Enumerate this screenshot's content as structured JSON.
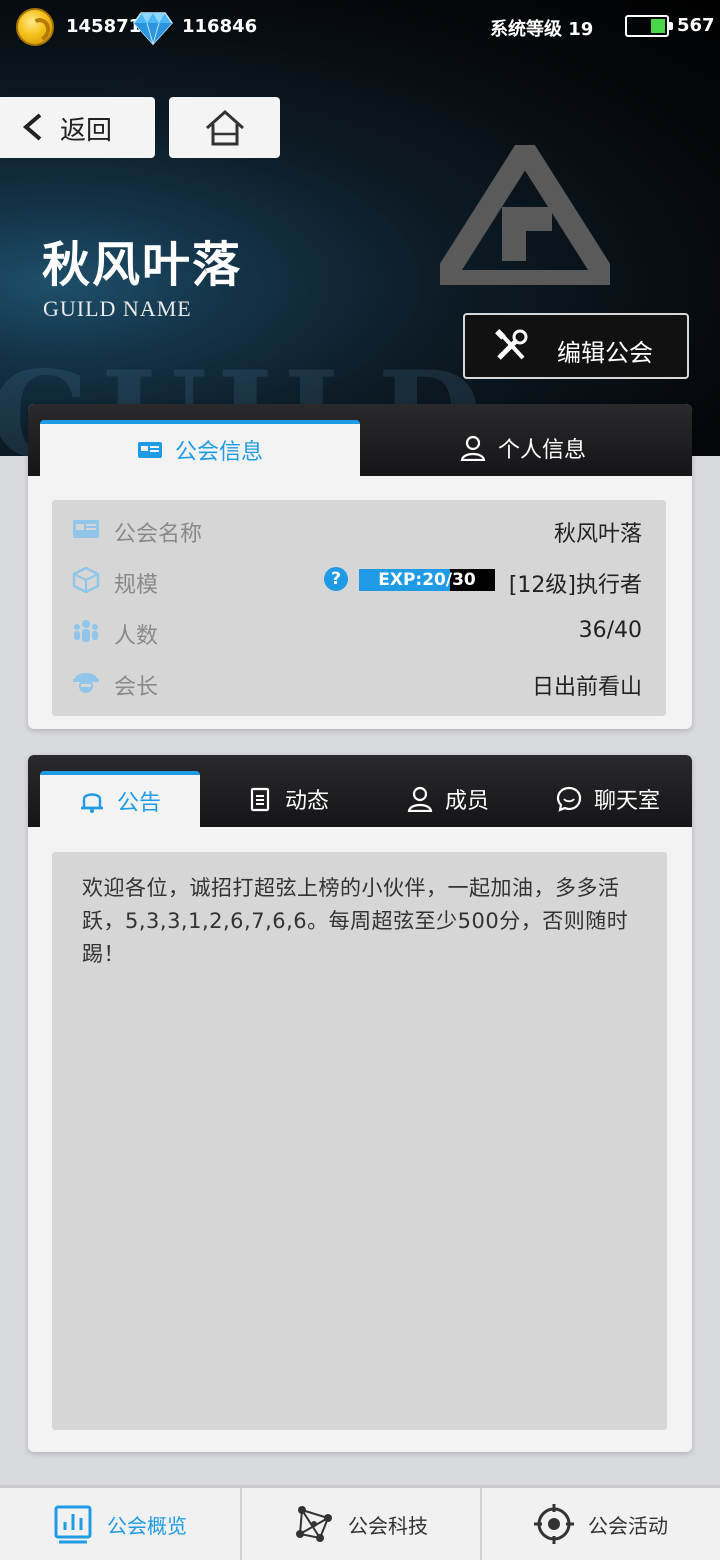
{
  "status_bar": {
    "coins": "145871",
    "diamonds": "116846",
    "system_level": "系统等级 19",
    "battery": "567"
  },
  "nav": {
    "back_label": "返回"
  },
  "guild": {
    "title": "秋风叶落",
    "subtitle": "GUILD NAME",
    "edit_label": "编辑公会"
  },
  "info_tabs": [
    {
      "label": "公会信息",
      "icon": "id-card-icon",
      "active": true
    },
    {
      "label": "个人信息",
      "icon": "person-icon",
      "active": false
    }
  ],
  "info": {
    "rows": [
      {
        "label": "公会名称",
        "value": "秋风叶落",
        "icon": "id-card-icon"
      },
      {
        "label": "规模",
        "value": "[12级]执行者",
        "icon": "cube-icon"
      },
      {
        "label": "人数",
        "value": "36/40",
        "icon": "people-icon"
      },
      {
        "label": "会长",
        "value": "日出前看山",
        "icon": "leader-icon"
      }
    ],
    "exp": {
      "text": "EXP:20/30",
      "current": 20,
      "max": 30
    }
  },
  "notice_tabs": [
    {
      "label": "公告",
      "icon": "bell-icon",
      "active": true
    },
    {
      "label": "动态",
      "icon": "clipboard-icon",
      "active": false
    },
    {
      "label": "成员",
      "icon": "person-icon",
      "active": false
    },
    {
      "label": "聊天室",
      "icon": "chat-icon",
      "active": false
    }
  ],
  "notice": {
    "text": "欢迎各位，诚招打超弦上榜的小伙伴，一起加油，多多活跃，5,3,3,1,2,6,7,6,6。每周超弦至少500分，否则随时踢！"
  },
  "bottom_nav": [
    {
      "label": "公会概览",
      "icon": "chart-icon",
      "active": true
    },
    {
      "label": "公会科技",
      "icon": "network-icon",
      "active": false
    },
    {
      "label": "公会活动",
      "icon": "target-icon",
      "active": false
    }
  ],
  "colors": {
    "accent": "#1f9be6",
    "panel": "#d6d6d7",
    "card": "#f3f3f4",
    "tabbar": "#1a1a1c"
  }
}
